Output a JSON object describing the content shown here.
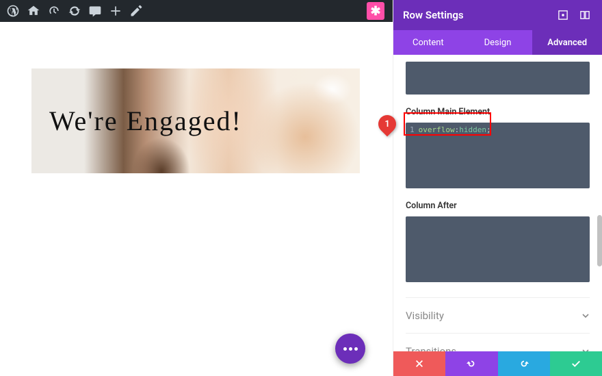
{
  "adminbar": {
    "brand_icon": "wordpress"
  },
  "canvas": {
    "hero_text": "We're Engaged!"
  },
  "panel": {
    "title": "Row Settings",
    "tabs": {
      "content": "Content",
      "design": "Design",
      "advanced": "Advanced",
      "active": "advanced"
    },
    "fields": {
      "main_label": "Column Main Element",
      "after_label": "Column After",
      "main_code_line": "1",
      "main_code": {
        "prop": "overflow",
        "sep": ":",
        "val": "hidden",
        "end": ";"
      }
    },
    "sections": {
      "visibility": "Visibility",
      "transitions": "Transitions"
    }
  },
  "annotation": {
    "number": "1"
  }
}
